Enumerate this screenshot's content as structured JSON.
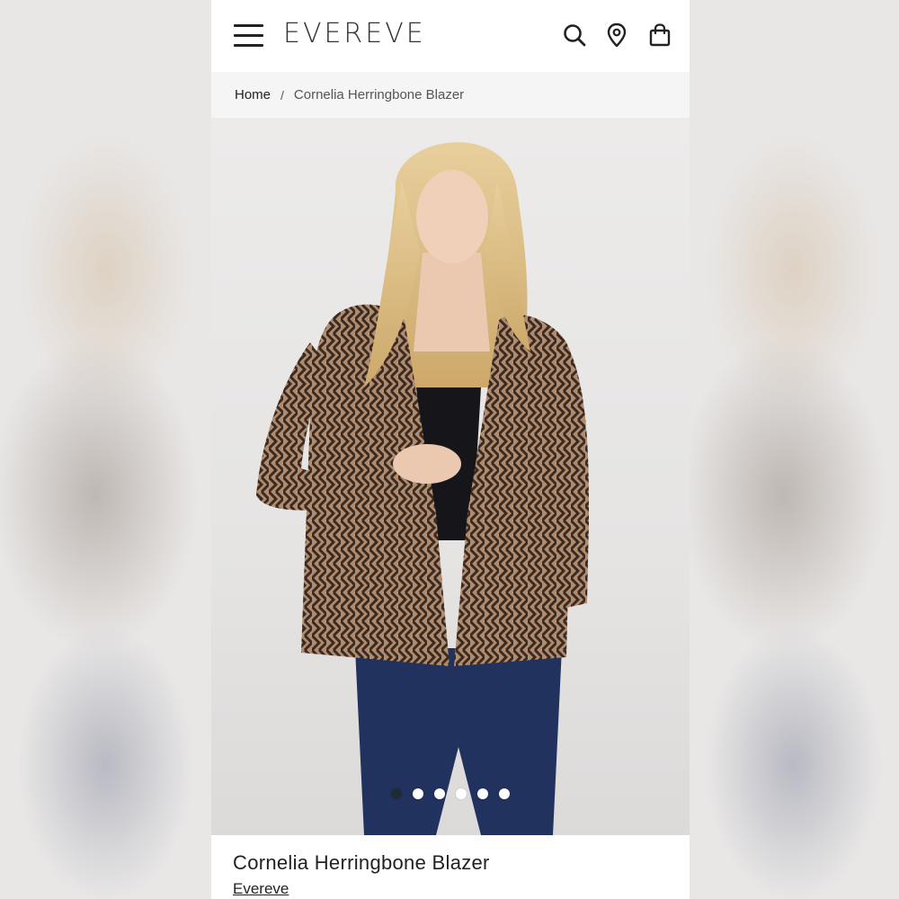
{
  "header": {
    "logo": "EVEREVE",
    "icons": [
      "menu-icon",
      "search-icon",
      "location-pin-icon",
      "shopping-bag-icon"
    ]
  },
  "breadcrumb": {
    "home": "Home",
    "separator": "/",
    "current": "Cornelia Herringbone Blazer"
  },
  "gallery": {
    "image_count": 6,
    "active_index": 0
  },
  "product": {
    "title": "Cornelia Herringbone Blazer",
    "brand": "Evereve"
  },
  "colors": {
    "text": "#222222",
    "breadcrumb_bg": "#f5f5f5",
    "dot_active": "#1e2b33"
  }
}
